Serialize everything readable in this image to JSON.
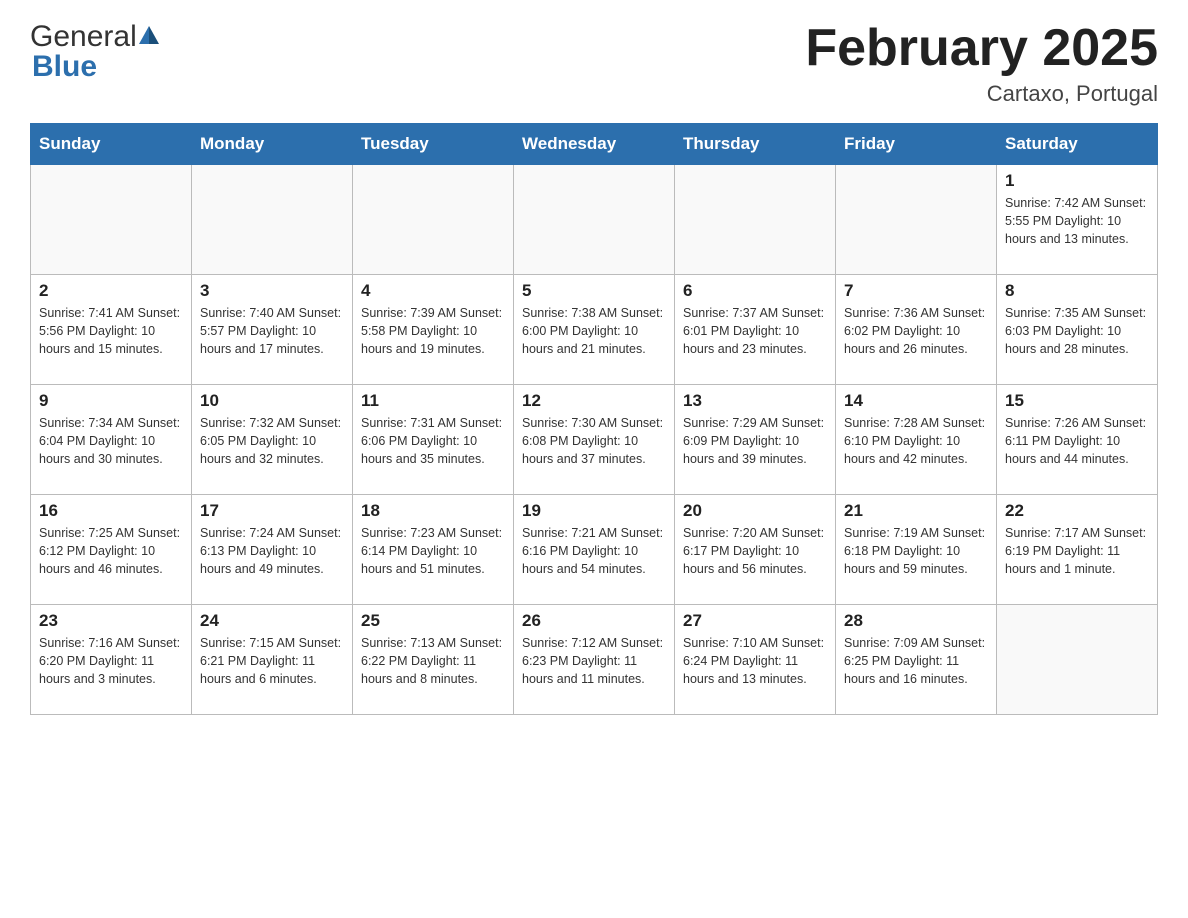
{
  "logo": {
    "general": "General",
    "blue": "Blue"
  },
  "header": {
    "title": "February 2025",
    "subtitle": "Cartaxo, Portugal"
  },
  "weekdays": [
    "Sunday",
    "Monday",
    "Tuesday",
    "Wednesday",
    "Thursday",
    "Friday",
    "Saturday"
  ],
  "weeks": [
    [
      {
        "day": "",
        "info": ""
      },
      {
        "day": "",
        "info": ""
      },
      {
        "day": "",
        "info": ""
      },
      {
        "day": "",
        "info": ""
      },
      {
        "day": "",
        "info": ""
      },
      {
        "day": "",
        "info": ""
      },
      {
        "day": "1",
        "info": "Sunrise: 7:42 AM\nSunset: 5:55 PM\nDaylight: 10 hours\nand 13 minutes."
      }
    ],
    [
      {
        "day": "2",
        "info": "Sunrise: 7:41 AM\nSunset: 5:56 PM\nDaylight: 10 hours\nand 15 minutes."
      },
      {
        "day": "3",
        "info": "Sunrise: 7:40 AM\nSunset: 5:57 PM\nDaylight: 10 hours\nand 17 minutes."
      },
      {
        "day": "4",
        "info": "Sunrise: 7:39 AM\nSunset: 5:58 PM\nDaylight: 10 hours\nand 19 minutes."
      },
      {
        "day": "5",
        "info": "Sunrise: 7:38 AM\nSunset: 6:00 PM\nDaylight: 10 hours\nand 21 minutes."
      },
      {
        "day": "6",
        "info": "Sunrise: 7:37 AM\nSunset: 6:01 PM\nDaylight: 10 hours\nand 23 minutes."
      },
      {
        "day": "7",
        "info": "Sunrise: 7:36 AM\nSunset: 6:02 PM\nDaylight: 10 hours\nand 26 minutes."
      },
      {
        "day": "8",
        "info": "Sunrise: 7:35 AM\nSunset: 6:03 PM\nDaylight: 10 hours\nand 28 minutes."
      }
    ],
    [
      {
        "day": "9",
        "info": "Sunrise: 7:34 AM\nSunset: 6:04 PM\nDaylight: 10 hours\nand 30 minutes."
      },
      {
        "day": "10",
        "info": "Sunrise: 7:32 AM\nSunset: 6:05 PM\nDaylight: 10 hours\nand 32 minutes."
      },
      {
        "day": "11",
        "info": "Sunrise: 7:31 AM\nSunset: 6:06 PM\nDaylight: 10 hours\nand 35 minutes."
      },
      {
        "day": "12",
        "info": "Sunrise: 7:30 AM\nSunset: 6:08 PM\nDaylight: 10 hours\nand 37 minutes."
      },
      {
        "day": "13",
        "info": "Sunrise: 7:29 AM\nSunset: 6:09 PM\nDaylight: 10 hours\nand 39 minutes."
      },
      {
        "day": "14",
        "info": "Sunrise: 7:28 AM\nSunset: 6:10 PM\nDaylight: 10 hours\nand 42 minutes."
      },
      {
        "day": "15",
        "info": "Sunrise: 7:26 AM\nSunset: 6:11 PM\nDaylight: 10 hours\nand 44 minutes."
      }
    ],
    [
      {
        "day": "16",
        "info": "Sunrise: 7:25 AM\nSunset: 6:12 PM\nDaylight: 10 hours\nand 46 minutes."
      },
      {
        "day": "17",
        "info": "Sunrise: 7:24 AM\nSunset: 6:13 PM\nDaylight: 10 hours\nand 49 minutes."
      },
      {
        "day": "18",
        "info": "Sunrise: 7:23 AM\nSunset: 6:14 PM\nDaylight: 10 hours\nand 51 minutes."
      },
      {
        "day": "19",
        "info": "Sunrise: 7:21 AM\nSunset: 6:16 PM\nDaylight: 10 hours\nand 54 minutes."
      },
      {
        "day": "20",
        "info": "Sunrise: 7:20 AM\nSunset: 6:17 PM\nDaylight: 10 hours\nand 56 minutes."
      },
      {
        "day": "21",
        "info": "Sunrise: 7:19 AM\nSunset: 6:18 PM\nDaylight: 10 hours\nand 59 minutes."
      },
      {
        "day": "22",
        "info": "Sunrise: 7:17 AM\nSunset: 6:19 PM\nDaylight: 11 hours\nand 1 minute."
      }
    ],
    [
      {
        "day": "23",
        "info": "Sunrise: 7:16 AM\nSunset: 6:20 PM\nDaylight: 11 hours\nand 3 minutes."
      },
      {
        "day": "24",
        "info": "Sunrise: 7:15 AM\nSunset: 6:21 PM\nDaylight: 11 hours\nand 6 minutes."
      },
      {
        "day": "25",
        "info": "Sunrise: 7:13 AM\nSunset: 6:22 PM\nDaylight: 11 hours\nand 8 minutes."
      },
      {
        "day": "26",
        "info": "Sunrise: 7:12 AM\nSunset: 6:23 PM\nDaylight: 11 hours\nand 11 minutes."
      },
      {
        "day": "27",
        "info": "Sunrise: 7:10 AM\nSunset: 6:24 PM\nDaylight: 11 hours\nand 13 minutes."
      },
      {
        "day": "28",
        "info": "Sunrise: 7:09 AM\nSunset: 6:25 PM\nDaylight: 11 hours\nand 16 minutes."
      },
      {
        "day": "",
        "info": ""
      }
    ]
  ]
}
